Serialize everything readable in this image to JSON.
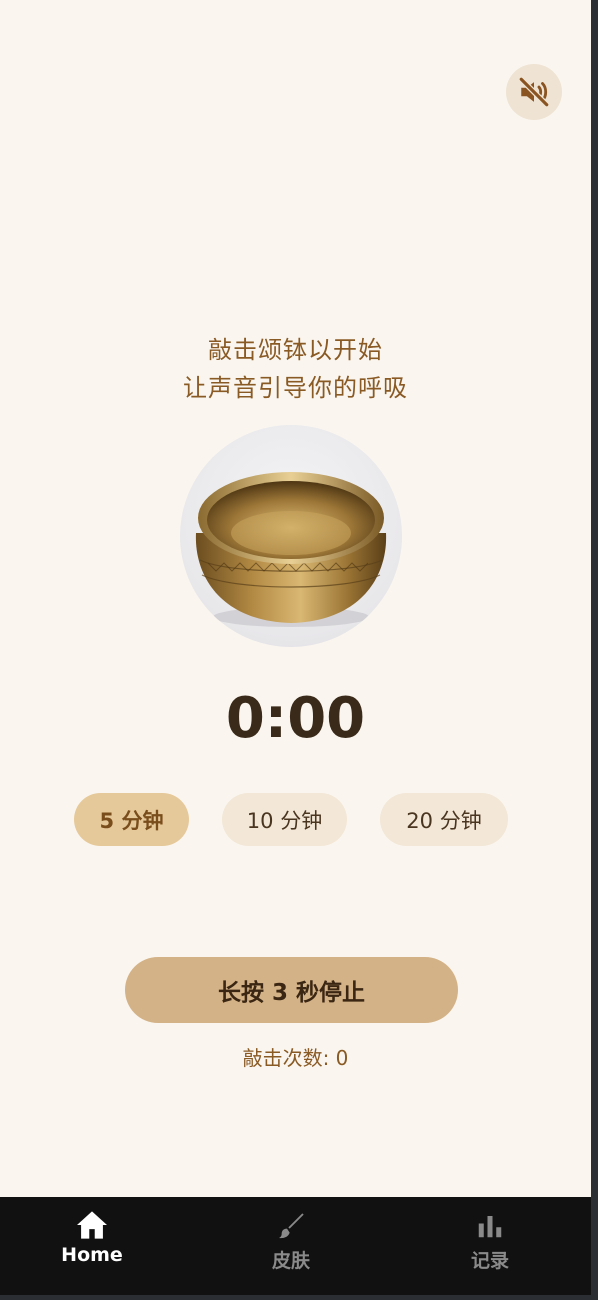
{
  "header": {
    "mute_icon": "volume-mute-icon"
  },
  "prompt": {
    "line1": "敲击颂钵以开始",
    "line2": "让声音引导你的呼吸"
  },
  "bowl": {
    "image": "singing-bowl-image"
  },
  "timer": {
    "display": "0:00"
  },
  "durations": [
    {
      "label": "5 分钟",
      "selected": true
    },
    {
      "label": "10 分钟",
      "selected": false
    },
    {
      "label": "20 分钟",
      "selected": false
    }
  ],
  "stop_button": {
    "label": "长按 3 秒停止"
  },
  "strike_count": {
    "text": "敲击次数: 0"
  },
  "nav": {
    "items": [
      {
        "label": "Home",
        "icon": "home-icon",
        "active": true
      },
      {
        "label": "皮肤",
        "icon": "paintbrush-icon",
        "active": false
      },
      {
        "label": "记录",
        "icon": "bar-chart-icon",
        "active": false
      }
    ]
  },
  "colors": {
    "background": "#faf6ef",
    "accent_text": "#8a5a25",
    "selected_pill": "#e6c99a",
    "unselected_pill": "#f3e7d7",
    "stop_button": "#d4b287",
    "nav_bg": "#111111"
  }
}
